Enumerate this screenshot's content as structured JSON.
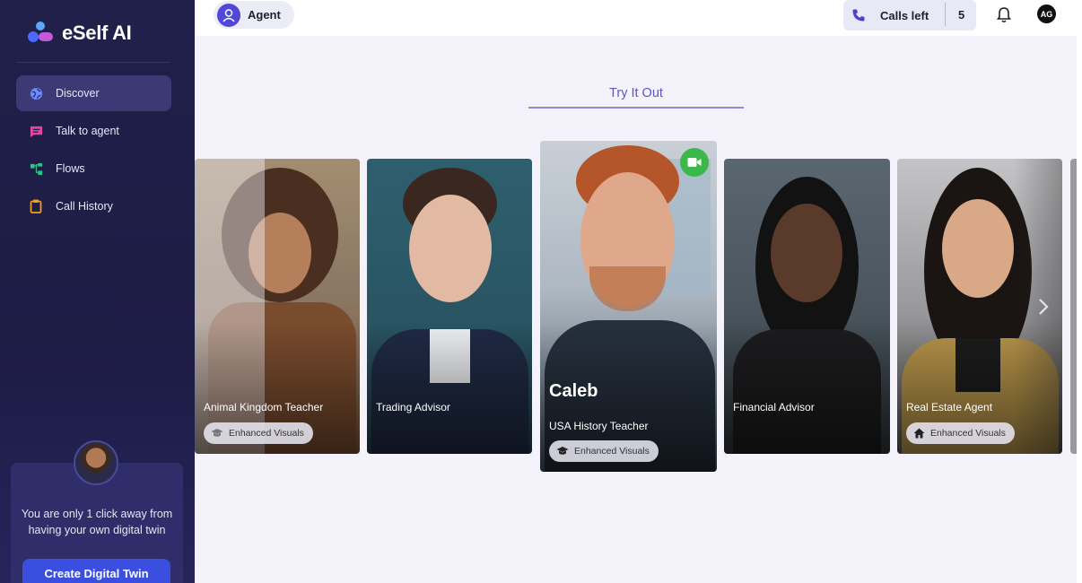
{
  "brand": {
    "name": "eSelf AI"
  },
  "sidebar": {
    "items": [
      {
        "label": "Discover",
        "icon": "globe-icon",
        "active": true,
        "color": "#6b8cff"
      },
      {
        "label": "Talk to agent",
        "icon": "chat-icon",
        "active": false,
        "color": "#e0479e"
      },
      {
        "label": "Flows",
        "icon": "flows-icon",
        "active": false,
        "color": "#35c08a"
      },
      {
        "label": "Call History",
        "icon": "clipboard-icon",
        "active": false,
        "color": "#f0a020"
      }
    ],
    "promo": {
      "text": "You are only 1 click away from having your own digital twin",
      "button_label": "Create Digital Twin"
    }
  },
  "header": {
    "agent_label": "Agent",
    "calls_label": "Calls left",
    "calls_count": "5",
    "user_initials": "AG"
  },
  "main": {
    "section_title": "Try It Out",
    "cards": [
      {
        "title": "Animal Kingdom Teacher",
        "badge": "Enhanced Visuals",
        "badge_icon": "graduation-cap-icon"
      },
      {
        "title": "Trading Advisor",
        "badge": "",
        "badge_icon": ""
      },
      {
        "name": "Caleb",
        "title": "USA History Teacher",
        "badge": "Enhanced Visuals",
        "badge_icon": "graduation-cap-icon",
        "featured": true
      },
      {
        "title": "Financial Advisor",
        "badge": "",
        "badge_icon": ""
      },
      {
        "title": "Real Estate Agent",
        "badge": "Enhanced Visuals",
        "badge_icon": "home-icon"
      }
    ]
  },
  "colors": {
    "sidebar_bg": "#20204a",
    "accent": "#3a4fe0",
    "try_it_text": "#5b55c8",
    "video_green": "#3cb84a"
  }
}
